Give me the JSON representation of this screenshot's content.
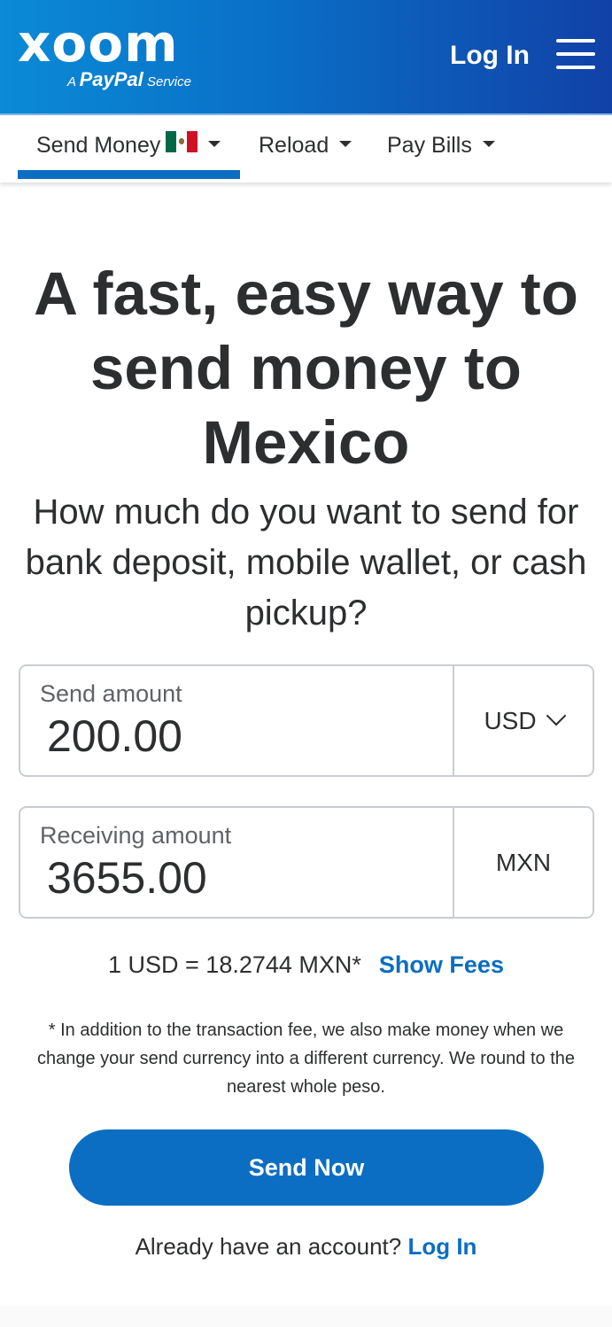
{
  "header": {
    "logo_word": "xoom",
    "logo_sub_prefix": "A",
    "logo_sub_brand": "PayPal",
    "logo_sub_suffix": "Service",
    "login_label": "Log In",
    "menu_icon": "hamburger-menu-icon"
  },
  "nav": {
    "tabs": [
      {
        "label": "Send Money",
        "flag": "mexico-flag-icon",
        "active": true
      },
      {
        "label": "Reload",
        "active": false
      },
      {
        "label": "Pay Bills",
        "active": false
      }
    ]
  },
  "hero": {
    "title": "A fast, easy way to send money to Mexico",
    "subtitle": "How much do you want to send for bank deposit, mobile wallet, or cash pickup?"
  },
  "send": {
    "label": "Send amount",
    "value": "200.00",
    "currency": "USD"
  },
  "receive": {
    "label": "Receiving amount",
    "value": "3655.00",
    "currency": "MXN"
  },
  "rate": {
    "text": "1 USD = 18.2744 MXN*",
    "show_fees_label": "Show Fees"
  },
  "disclaimer": "* In addition to the transaction fee, we also make money when we change your send currency into a different currency. We round to the nearest whole peso.",
  "cta": {
    "send_now_label": "Send Now"
  },
  "account": {
    "prompt": "Already have an account?",
    "login_label": "Log In"
  },
  "colors": {
    "brand_blue": "#0b6ec2",
    "header_gradient_start": "#0b8ad6",
    "header_gradient_end": "#1141a6"
  }
}
